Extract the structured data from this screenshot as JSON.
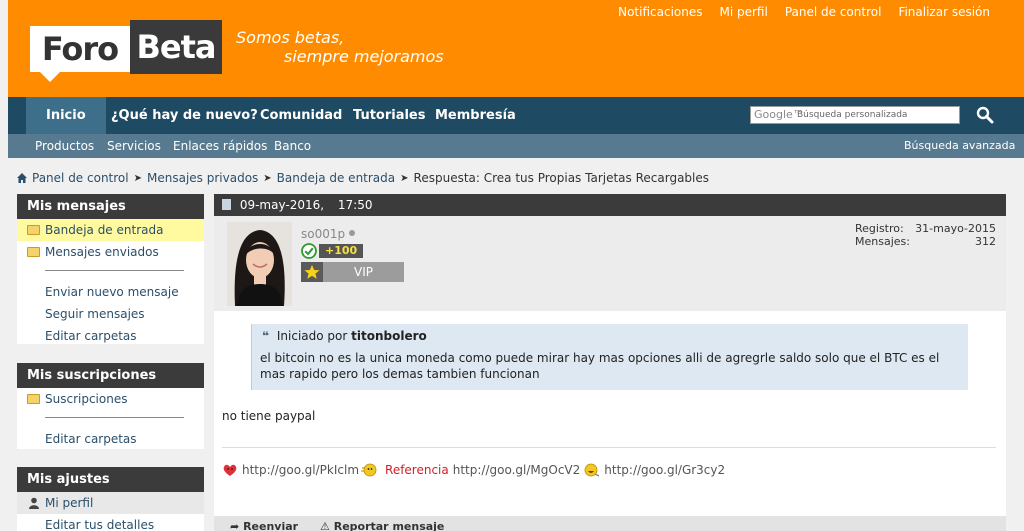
{
  "header": {
    "logo_left": "Foro",
    "logo_right": "Beta",
    "slogan_line1": "Somos betas,",
    "slogan_line2": "siempre mejoramos",
    "toplinks": [
      "Notificaciones",
      "Mi perfil",
      "Panel de control",
      "Finalizar sesión"
    ]
  },
  "nav": {
    "tabs": [
      "Inicio",
      "¿Qué hay de nuevo?",
      "Comunidad",
      "Tutoriales",
      "Membresía"
    ],
    "search_brand": "Google™",
    "search_placeholder": "Búsqueda personalizada"
  },
  "subnav": {
    "items": [
      "Productos",
      "Servicios",
      "Enlaces rápidos",
      "Banco"
    ],
    "advanced": "Búsqueda avanzada"
  },
  "breadcrumb": [
    "Panel de control",
    "Mensajes privados",
    "Bandeja de entrada",
    "Respuesta: Crea tus Propias Tarjetas Recargables"
  ],
  "sidebar": {
    "mensajes": {
      "title": "Mis mensajes",
      "items": [
        "Bandeja de entrada",
        "Mensajes enviados"
      ],
      "links": [
        "Enviar nuevo mensaje",
        "Seguir mensajes",
        "Editar carpetas"
      ]
    },
    "suscripciones": {
      "title": "Mis suscripciones",
      "items": [
        "Suscripciones"
      ],
      "links": [
        "Editar carpetas"
      ]
    },
    "ajustes": {
      "title": "Mis ajustes",
      "items": [
        "Mi perfil",
        "Editar tus detalles"
      ]
    }
  },
  "post": {
    "date": "09-may-2016,",
    "time": "17:50",
    "username": "so001p",
    "reputation": "+100",
    "rank": "VIP",
    "registro_label": "Registro:",
    "registro_value": "31-mayo-2015",
    "mensajes_label": "Mensajes:",
    "mensajes_value": "312",
    "quote_prefix": "Iniciado por",
    "quote_author": "titonbolero",
    "quote_text": "el bitcoin no es la unica moneda como puede mirar hay mas opciones alli de agregrle saldo solo que el BTC es el mas rapido pero los demas tambien funcionan",
    "message": "no tiene paypal",
    "signature": {
      "link1": "http://goo.gl/PkIclm",
      "ref_label": "Referencia",
      "link2": "http://goo.gl/MgOcV2",
      "link3": "http://goo.gl/Gr3cy2"
    },
    "actions": [
      "Reenviar",
      "Reportar mensaje"
    ]
  },
  "colors": {
    "header_orange": "#ff8c00",
    "nav_blue": "#1e4a63",
    "subnav_blue": "#577a90",
    "active_yellow": "#fffaa0",
    "quote_bg": "#dde8f2"
  }
}
